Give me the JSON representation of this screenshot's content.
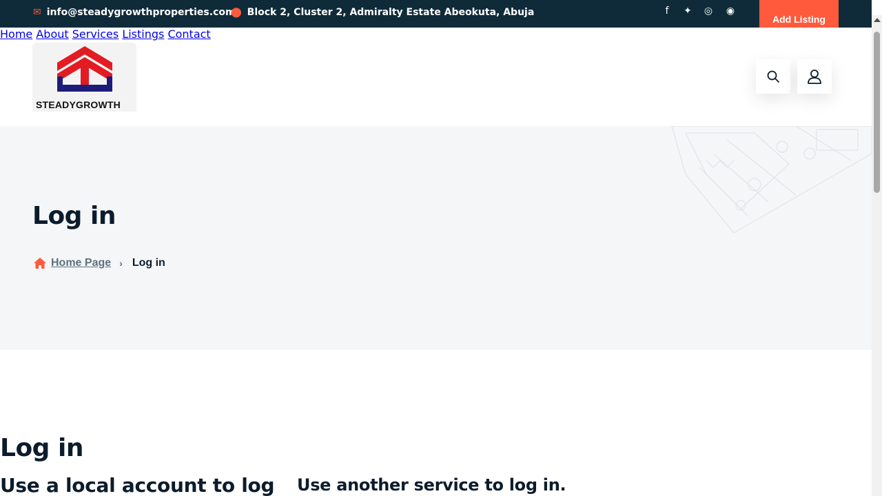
{
  "topbar": {
    "email": "info@steadygrowthproperties.com",
    "address": "Block 2, Cluster 2, Admiralty Estate Abeokuta, Abuja",
    "add_listing": "Add Listing",
    "social_icons": [
      "facebook-icon",
      "twitter-icon",
      "instagram-icon",
      "dribbble-icon"
    ]
  },
  "logo": {
    "text": "STEADYGROWTH"
  },
  "nav": {
    "items": [
      {
        "label": "Home"
      },
      {
        "label": "About"
      },
      {
        "label": "Services"
      },
      {
        "label": "Listings"
      },
      {
        "label": "Contact"
      }
    ]
  },
  "banner": {
    "title": "Log in",
    "breadcrumb": {
      "home": "Home Page",
      "current": "Log in"
    }
  },
  "main": {
    "title": "Log in",
    "local_heading": "Use a local account to log in.",
    "external_heading": "Use another service to log in."
  },
  "colors": {
    "accent": "#ff5a3c",
    "dark": "#0f2b3a",
    "banner_bg": "#f5f6f8"
  }
}
